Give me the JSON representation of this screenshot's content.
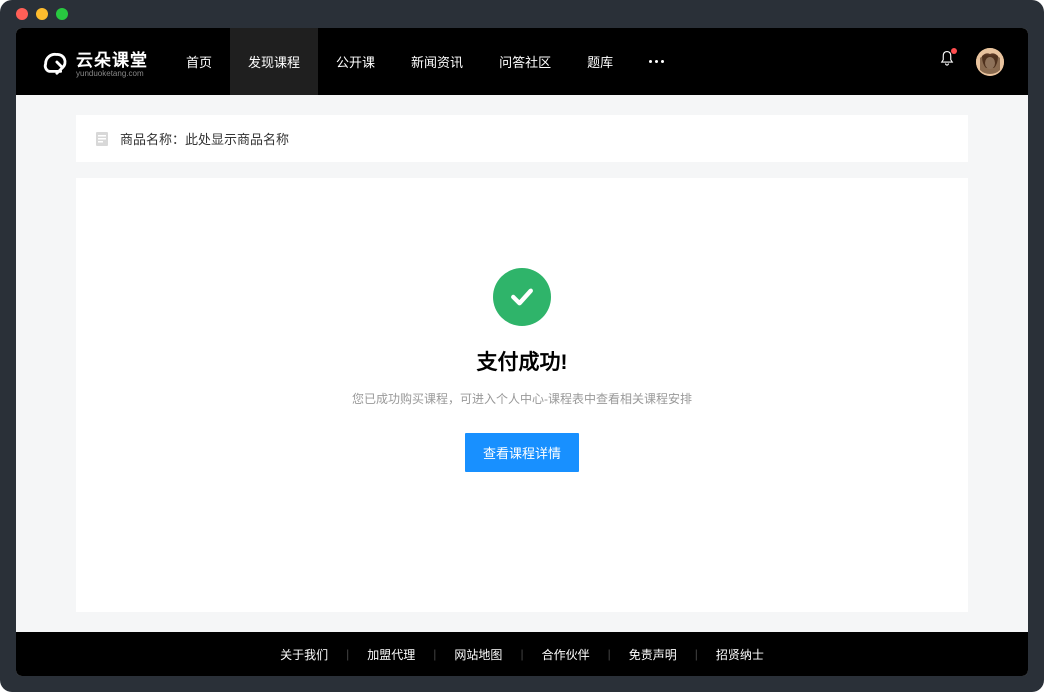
{
  "logo": {
    "main": "云朵课堂",
    "sub": "yunduoketang.com"
  },
  "nav": {
    "items": [
      {
        "label": "首页",
        "active": false
      },
      {
        "label": "发现课程",
        "active": true
      },
      {
        "label": "公开课",
        "active": false
      },
      {
        "label": "新闻资讯",
        "active": false
      },
      {
        "label": "问答社区",
        "active": false
      },
      {
        "label": "题库",
        "active": false
      }
    ]
  },
  "product": {
    "label": "商品名称：",
    "value": "此处显示商品名称"
  },
  "success": {
    "title": "支付成功!",
    "subtitle": "您已成功购买课程，可进入个人中心-课程表中查看相关课程安排",
    "button": "查看课程详情"
  },
  "footer": {
    "links": [
      "关于我们",
      "加盟代理",
      "网站地图",
      "合作伙伴",
      "免责声明",
      "招贤纳士"
    ]
  },
  "colors": {
    "primary": "#1890ff",
    "success": "#2fb46a",
    "danger": "#ff4d4f"
  }
}
